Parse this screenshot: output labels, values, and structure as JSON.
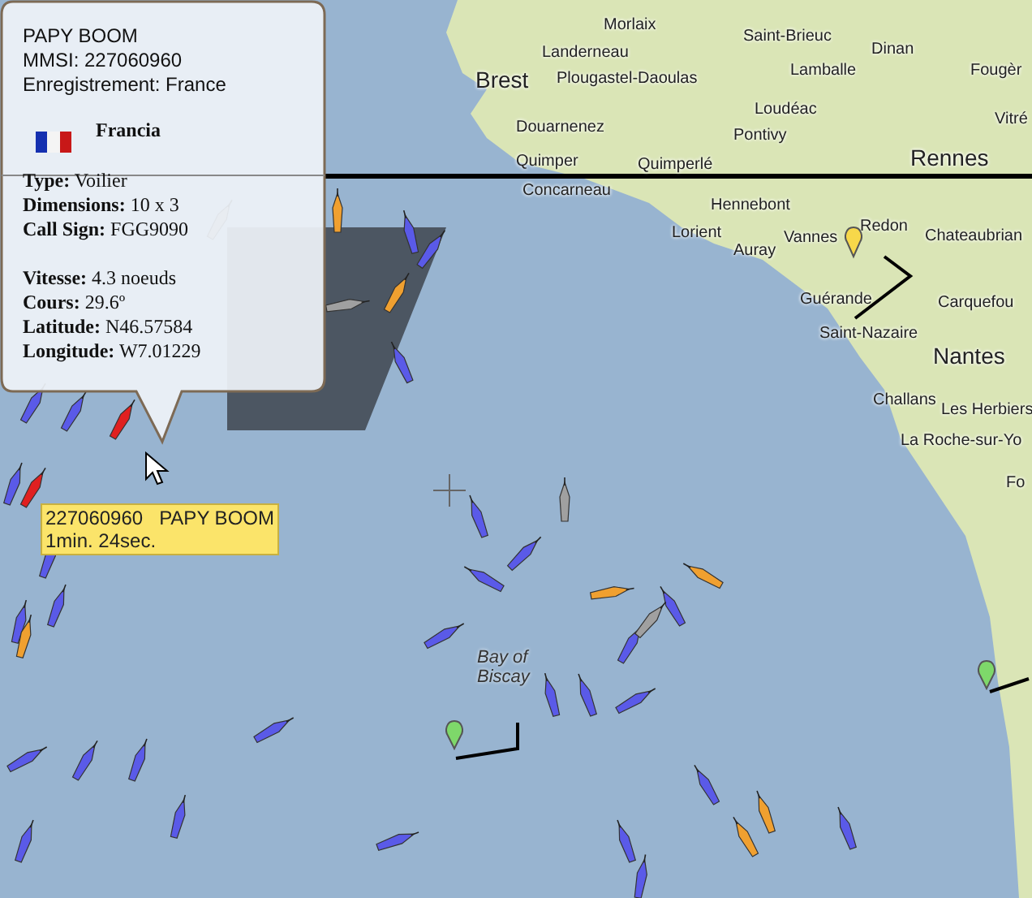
{
  "popup": {
    "title": "PAPY BOOM",
    "mmsi": "MMSI: 227060960",
    "registration": "Enregistrement: France",
    "flag_label": "Francia",
    "details": [
      "**Type:** Voilier",
      "**Dimensions:** 10 x 3",
      "**Call Sign:** FGG9090"
    ],
    "motion": [
      "**Vitesse:** 4.3 noeuds",
      "**Cours:** 29.6º",
      "**Latitude:**  N46.57584",
      "**Longitude:**  W7.01229"
    ]
  },
  "tooltip": {
    "line_1": "227060960   PAPY BOOM",
    "line_2": "1min. 24sec."
  },
  "map": {
    "places": [
      {
        "name": "Morlaix",
        "kind": "town"
      },
      {
        "name": "Landerneau",
        "kind": "town"
      },
      {
        "name": "Brest",
        "kind": "city"
      },
      {
        "name": "Plougastel-Daoulas",
        "kind": "town"
      },
      {
        "name": "Saint-Brieuc",
        "kind": "town"
      },
      {
        "name": "Lamballe",
        "kind": "town"
      },
      {
        "name": "Dinan",
        "kind": "town"
      },
      {
        "name": "Fougèr",
        "kind": "town"
      },
      {
        "name": "Loudéac",
        "kind": "town"
      },
      {
        "name": "Pontivy",
        "kind": "town"
      },
      {
        "name": "Douarnenez",
        "kind": "town"
      },
      {
        "name": "Quimper",
        "kind": "town"
      },
      {
        "name": "Quimperlé",
        "kind": "town"
      },
      {
        "name": "Concarneau",
        "kind": "town"
      },
      {
        "name": "Rennes",
        "kind": "city"
      },
      {
        "name": "Vitré",
        "kind": "town"
      },
      {
        "name": "Hennebont",
        "kind": "town"
      },
      {
        "name": "Lorient",
        "kind": "town"
      },
      {
        "name": "Auray",
        "kind": "town"
      },
      {
        "name": "Vannes",
        "kind": "town"
      },
      {
        "name": "Redon",
        "kind": "town"
      },
      {
        "name": "Chateaubrian",
        "kind": "town"
      },
      {
        "name": "Guérande",
        "kind": "town"
      },
      {
        "name": "Saint-Nazaire",
        "kind": "town"
      },
      {
        "name": "Carquefou",
        "kind": "town"
      },
      {
        "name": "Nantes",
        "kind": "city"
      },
      {
        "name": "Challans",
        "kind": "town"
      },
      {
        "name": "Les Herbiers",
        "kind": "town"
      },
      {
        "name": "La Roche-sur-Yo",
        "kind": "town"
      },
      {
        "name": "Fo",
        "kind": "town"
      }
    ],
    "sea_label": [
      "Bay of",
      "Biscay"
    ]
  }
}
